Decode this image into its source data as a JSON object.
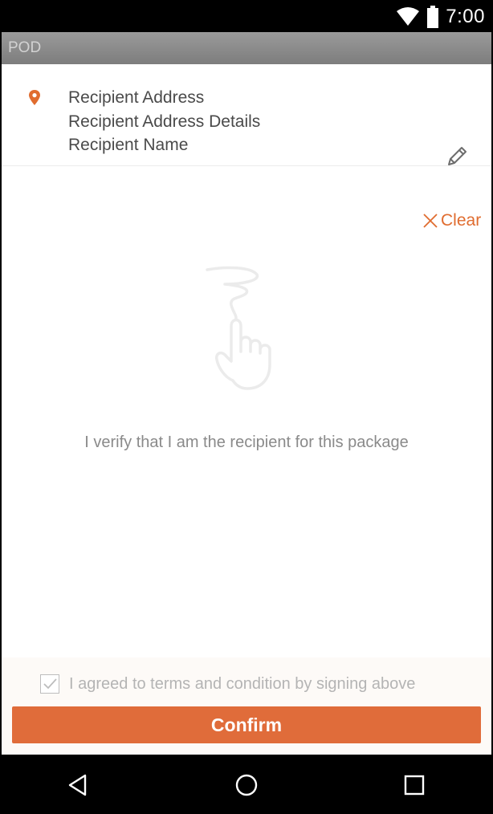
{
  "status_bar": {
    "time": "7:00",
    "icons": [
      "wifi-icon",
      "battery-icon"
    ]
  },
  "app_bar": {
    "title": "POD"
  },
  "recipient": {
    "icon": "location-pin-icon",
    "address": "Recipient Address",
    "address_details": "Recipient Address Details",
    "name": "Recipient Name",
    "edit_icon": "pencil-icon"
  },
  "signature_pad": {
    "clear_label": "Clear",
    "clear_icon": "close-icon",
    "hint_icon": "hand-signature-icon",
    "verify_text": "I verify that I am the recipient for this package"
  },
  "terms": {
    "checked": true,
    "label": "I agreed to terms and condition by signing above"
  },
  "confirm": {
    "label": "Confirm"
  },
  "nav_bar": {
    "buttons": [
      "back-icon",
      "home-icon",
      "recents-icon"
    ]
  },
  "colors": {
    "accent": "#e06c2f",
    "button": "#e06c3a",
    "app_bar": "#8a8a8a"
  }
}
